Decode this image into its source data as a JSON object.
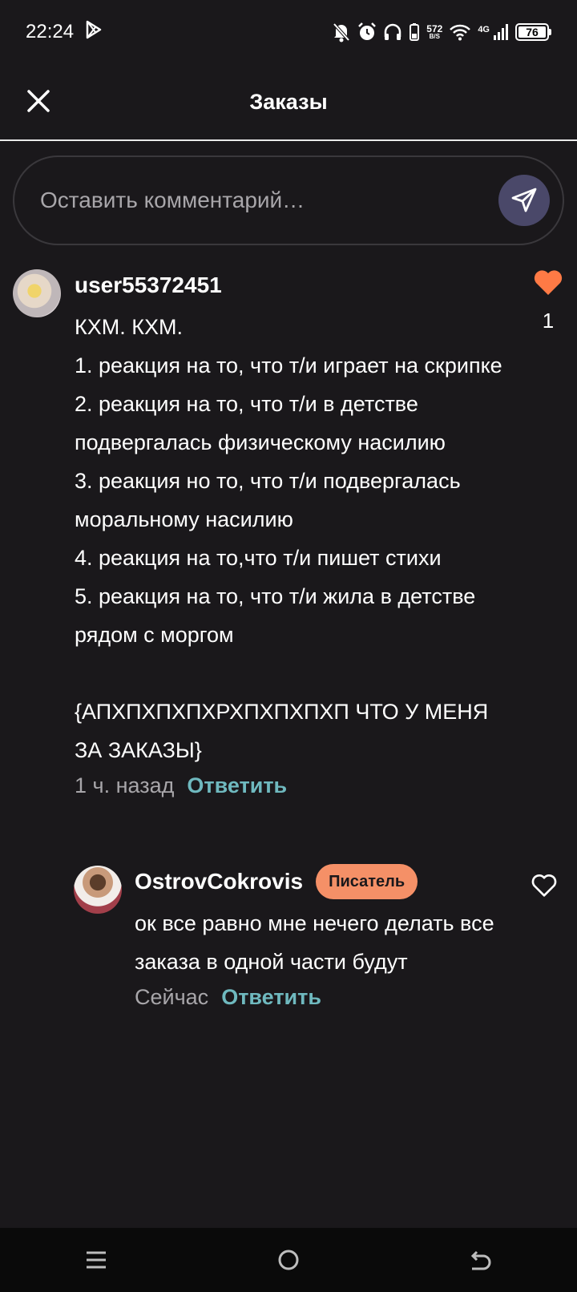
{
  "status_bar": {
    "time": "22:24",
    "net_speed": "572",
    "net_unit": "B/S",
    "network": "4G",
    "battery": "76",
    "icons": [
      "play-store-icon",
      "mute-icon",
      "alarm-icon",
      "headphones-icon",
      "battery-saver-icon",
      "wifi-icon",
      "signal-icon",
      "battery-icon"
    ]
  },
  "header": {
    "title": "Заказы",
    "close_icon": "close-icon"
  },
  "comment_input": {
    "placeholder": "Оставить комментарий…",
    "send_icon": "send-icon"
  },
  "comments": [
    {
      "username": "user55372451",
      "text": "КХМ. КХМ.\n1. реакция на то, что т/и играет на скрипке\n2. реакция на то, что т/и в детстве подвергалась физическому насилию\n3. реакция но то, что т/и подвергалась моральному насилию\n4. реакция на то,что т/и пишет стихи\n5. реакция на то, что т/и жила в детстве рядом с моргом\n\n{АПХПХПХПХРХПХПХПХП ЧТО У МЕНЯ ЗА ЗАКАЗЫ}",
      "time": "1 ч. назад",
      "reply_label": "Ответить",
      "likes": "1",
      "liked": true
    }
  ],
  "replies": [
    {
      "username": "OstrovCokrovis",
      "badge": "Писатель",
      "text": "ок все равно мне нечего делать все заказа в одной части будут",
      "time": "Сейчас",
      "reply_label": "Ответить",
      "liked": false
    }
  ],
  "colors": {
    "background": "#1a181b",
    "accent_like": "#ff7a45",
    "reply_link": "#6fb9bf",
    "badge": "#f59067",
    "send_button": "#4a4869"
  },
  "nav_bar": {
    "icons": [
      "menu-icon",
      "home-icon",
      "back-icon"
    ]
  }
}
